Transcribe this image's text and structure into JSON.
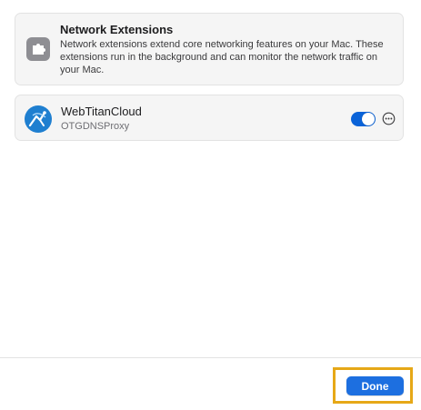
{
  "info_card": {
    "icon": "puzzle-piece-icon",
    "title": "Network Extensions",
    "description": "Network extensions extend core networking features on your Mac. These extensions run in the background and can monitor the network traffic on your Mac."
  },
  "extension": {
    "icon": "webtitan-logo-icon",
    "name": "WebTitanCloud",
    "subtitle": "OTGDNSProxy",
    "enabled": true,
    "more_icon": "ellipsis-circle-icon"
  },
  "footer": {
    "done_label": "Done"
  },
  "colors": {
    "accent": "#1d6fe0",
    "toggle_on": "#0a63d8",
    "highlight": "#e6a817",
    "app_icon": "#1f7fd0"
  }
}
